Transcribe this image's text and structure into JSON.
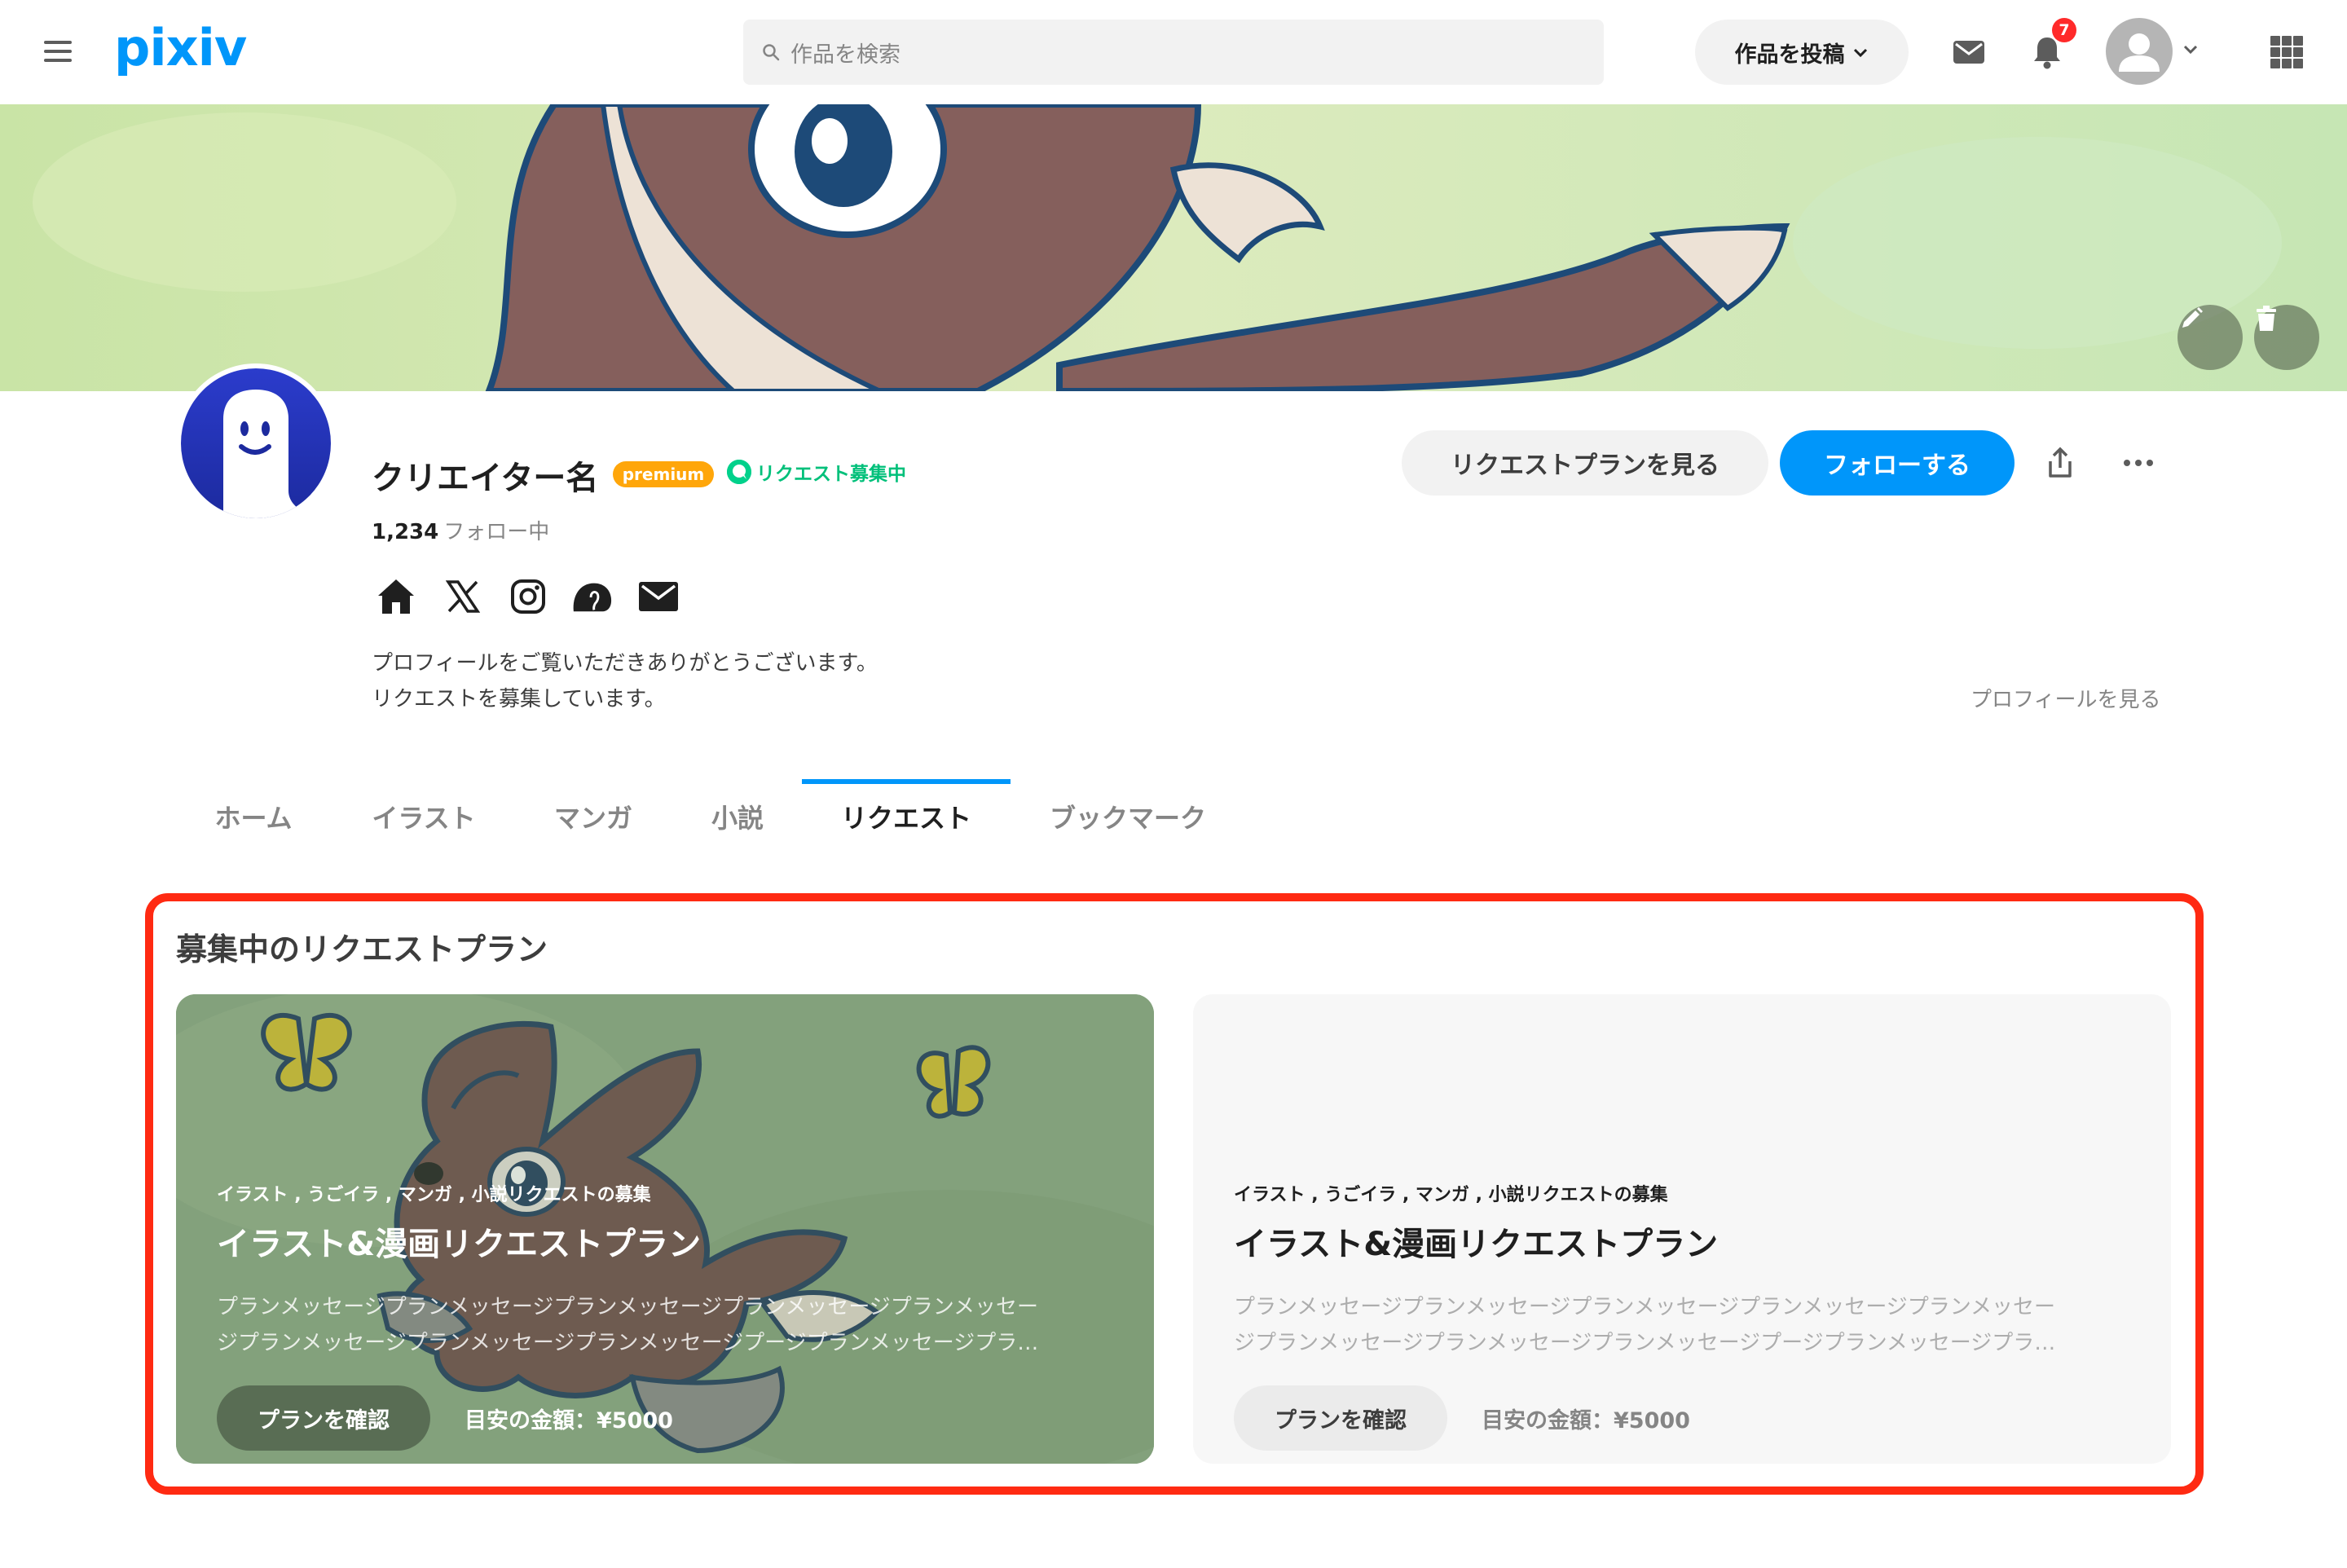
{
  "header": {
    "logo": "pixiv",
    "search_placeholder": "作品を検索",
    "post_button": "作品を投稿",
    "notification_count": "7"
  },
  "profile": {
    "name": "クリエイター名",
    "premium_badge": "premium",
    "request_status": "リクエスト募集中",
    "follow_count": "1,234",
    "follow_label": "フォロー中",
    "bio_line1": "プロフィールをご覧いただきありがとうございます。",
    "bio_line2": "リクエストを募集しています。",
    "profile_link": "プロフィールを見る",
    "view_plans_button": "リクエストプランを見る",
    "follow_button": "フォローする",
    "social_icons": [
      "home-icon",
      "x-icon",
      "instagram-icon",
      "mastodon-icon",
      "mail-icon"
    ]
  },
  "tabs": [
    {
      "label": "ホーム",
      "active": false
    },
    {
      "label": "イラスト",
      "active": false
    },
    {
      "label": "マンガ",
      "active": false
    },
    {
      "label": "小説",
      "active": false
    },
    {
      "label": "リクエスト",
      "active": true
    },
    {
      "label": "ブックマーク",
      "active": false
    }
  ],
  "request_section": {
    "title": "募集中のリクエストプラン",
    "cards": [
      {
        "category": "イラスト , うごイラ , マンガ , 小説リクエストの募集",
        "title": "イラスト&漫画リクエストプラン",
        "message_line1": "プランメッセージプランメッセージプランメッセージプランメッセージプランメッセー",
        "message_line2": "ジプランメッセージプランメッセージプランメッセージプージプランメッセージプラ…",
        "confirm_button": "プランを確認",
        "price": "目安の金額：¥5000",
        "has_image": true
      },
      {
        "category": "イラスト , うごイラ , マンガ , 小説リクエストの募集",
        "title": "イラスト&漫画リクエストプラン",
        "message_line1": "プランメッセージプランメッセージプランメッセージプランメッセージプランメッセー",
        "message_line2": "ジプランメッセージプランメッセージプランメッセージプージプランメッセージプラ…",
        "confirm_button": "プランを確認",
        "price": "目安の金額：¥5000",
        "has_image": false
      }
    ]
  },
  "colors": {
    "brand": "#0096fa",
    "premium": "#ffa60a",
    "request_green": "#00c07a",
    "highlight_border": "#ff2a12",
    "badge_red": "#ff2a2a"
  }
}
